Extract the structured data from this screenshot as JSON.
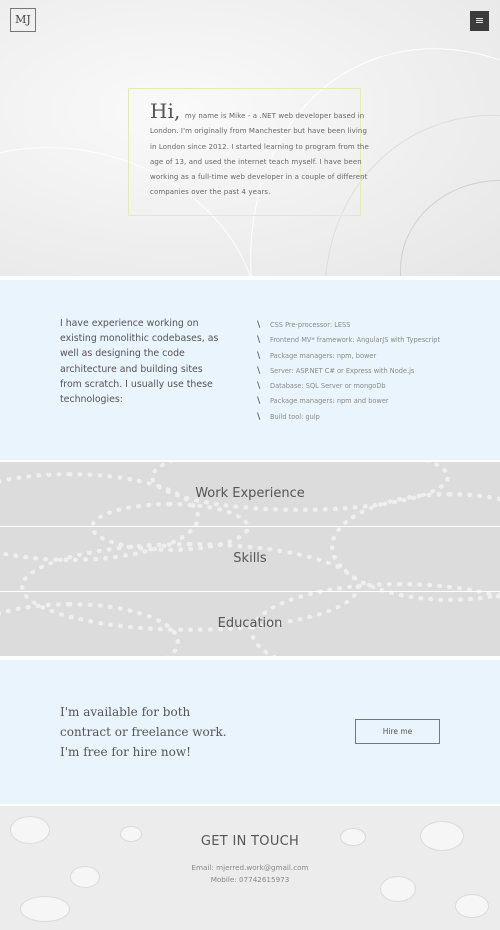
{
  "header": {
    "logo": "MJ",
    "menu_icon": "hamburger-icon",
    "menu_glyph": "≡"
  },
  "intro": {
    "greeting": "Hi,",
    "text": "my name is Mike - a .NET web developer based in London. I'm originally from Manchester but have been living in London since 2012. I started learning to program from the age of 13, and used the internet teach myself. I have been working as a full-time web developer in a couple of different companies over the past 4 years."
  },
  "tech": {
    "paragraph": "I have experience working on existing monolithic codebases, as well as designing the code architecture and building sites from scratch. I usually use these technologies:",
    "tick_glyph": "\\",
    "items": [
      "CSS Pre-processor: LESS",
      "Frontend MV* framework: AngularJS with Typescript",
      "Package managers: npm, bower",
      "Server: ASP.NET C# or Express with Node.js",
      "Database: SQL Server or mongoDb",
      "Package managers: npm and bower",
      "Build tool: gulp"
    ]
  },
  "sections": {
    "work_experience": "Work Experience",
    "skills": "Skills",
    "education": "Education"
  },
  "hire": {
    "text_line1": "I'm available for both",
    "text_line2": "contract or freelance work.",
    "text_line3": "I'm free for hire now!",
    "button": "Hire me"
  },
  "contact": {
    "title": "GET IN TOUCH",
    "email_line": "Email: mjerred.work@gmail.com",
    "mobile_line": "Mobile: 07742615973"
  },
  "colors": {
    "accent_frame": "#e6ebb0",
    "section_bg": "#eaf4fd",
    "menu_bg": "#3b3b3b"
  }
}
